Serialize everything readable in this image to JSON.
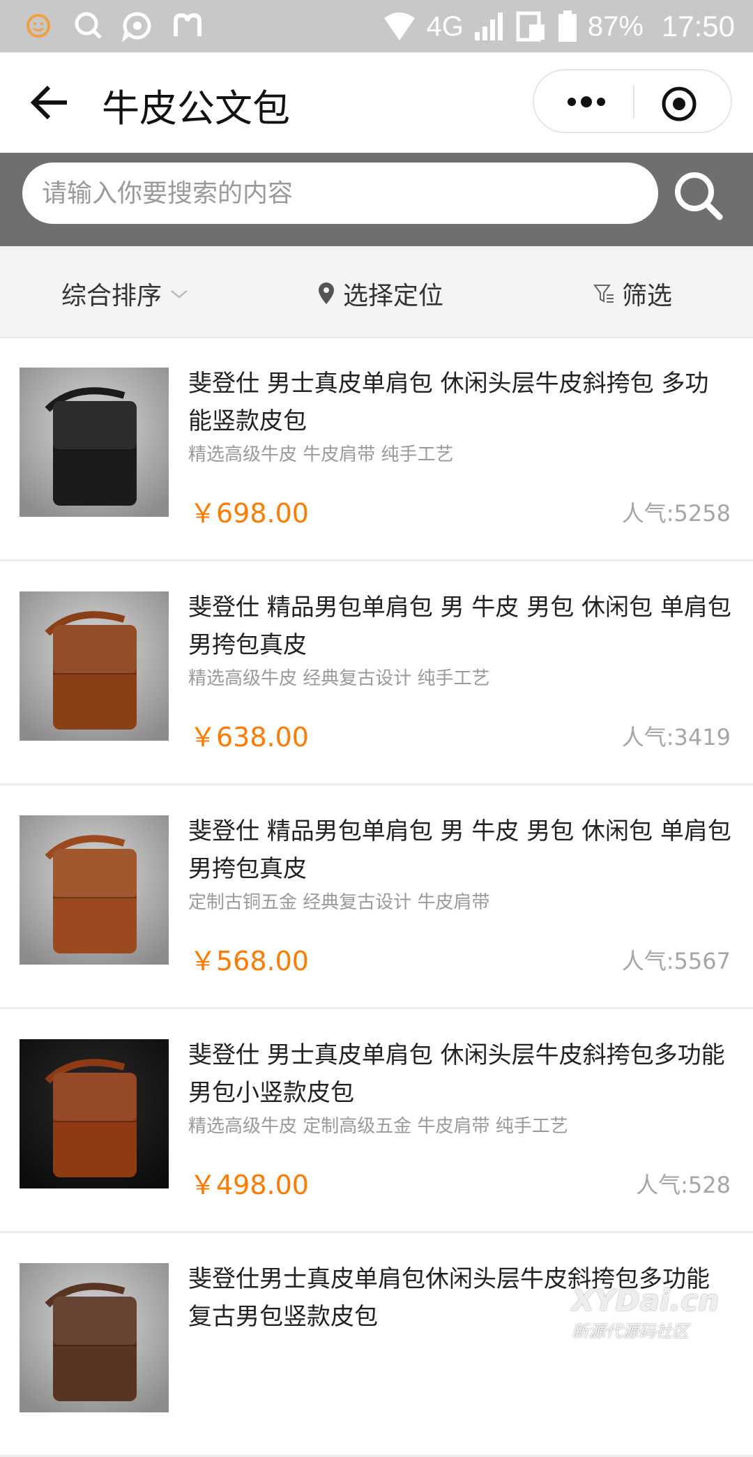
{
  "status_bar": {
    "network": "4G",
    "battery": "87%",
    "time": "17:50"
  },
  "nav": {
    "title": "牛皮公文包"
  },
  "search": {
    "placeholder": "请输入你要搜索的内容"
  },
  "filters": {
    "sort": "综合排序",
    "location": "选择定位",
    "filter": "筛选"
  },
  "products": [
    {
      "title": "斐登仕 男士真皮单肩包 休闲头层牛皮斜挎包 多功能竖款皮包",
      "tags": "精选高级牛皮 牛皮肩带 纯手工艺",
      "price": "￥698.00",
      "popularity": "人气:5258",
      "color": "#1b1b1b"
    },
    {
      "title": "斐登仕 精品男包单肩包 男 牛皮 男包 休闲包 单肩包 男挎包真皮",
      "tags": "精选高级牛皮 经典复古设计 纯手工艺",
      "price": "￥638.00",
      "popularity": "人气:3419",
      "color": "#8a3f17"
    },
    {
      "title": "斐登仕 精品男包单肩包 男 牛皮 男包 休闲包 单肩包 男挎包真皮",
      "tags": "定制古铜五金 经典复古设计 牛皮肩带",
      "price": "￥568.00",
      "popularity": "人气:5567",
      "color": "#9a4a1e"
    },
    {
      "title": "斐登仕 男士真皮单肩包 休闲头层牛皮斜挎包多功能男包小竖款皮包",
      "tags": "精选高级牛皮 定制高级五金 牛皮肩带 纯手工艺",
      "price": "￥498.00",
      "popularity": "人气:528",
      "color": "#8e3a14"
    },
    {
      "title": "斐登仕男士真皮单肩包休闲头层牛皮斜挎包多功能复古男包竖款皮包",
      "tags": "",
      "price": "",
      "popularity": "",
      "color": "#5a3422"
    }
  ],
  "watermark": {
    "main": "XYDai.cn",
    "sub": "新源代源码社区"
  }
}
